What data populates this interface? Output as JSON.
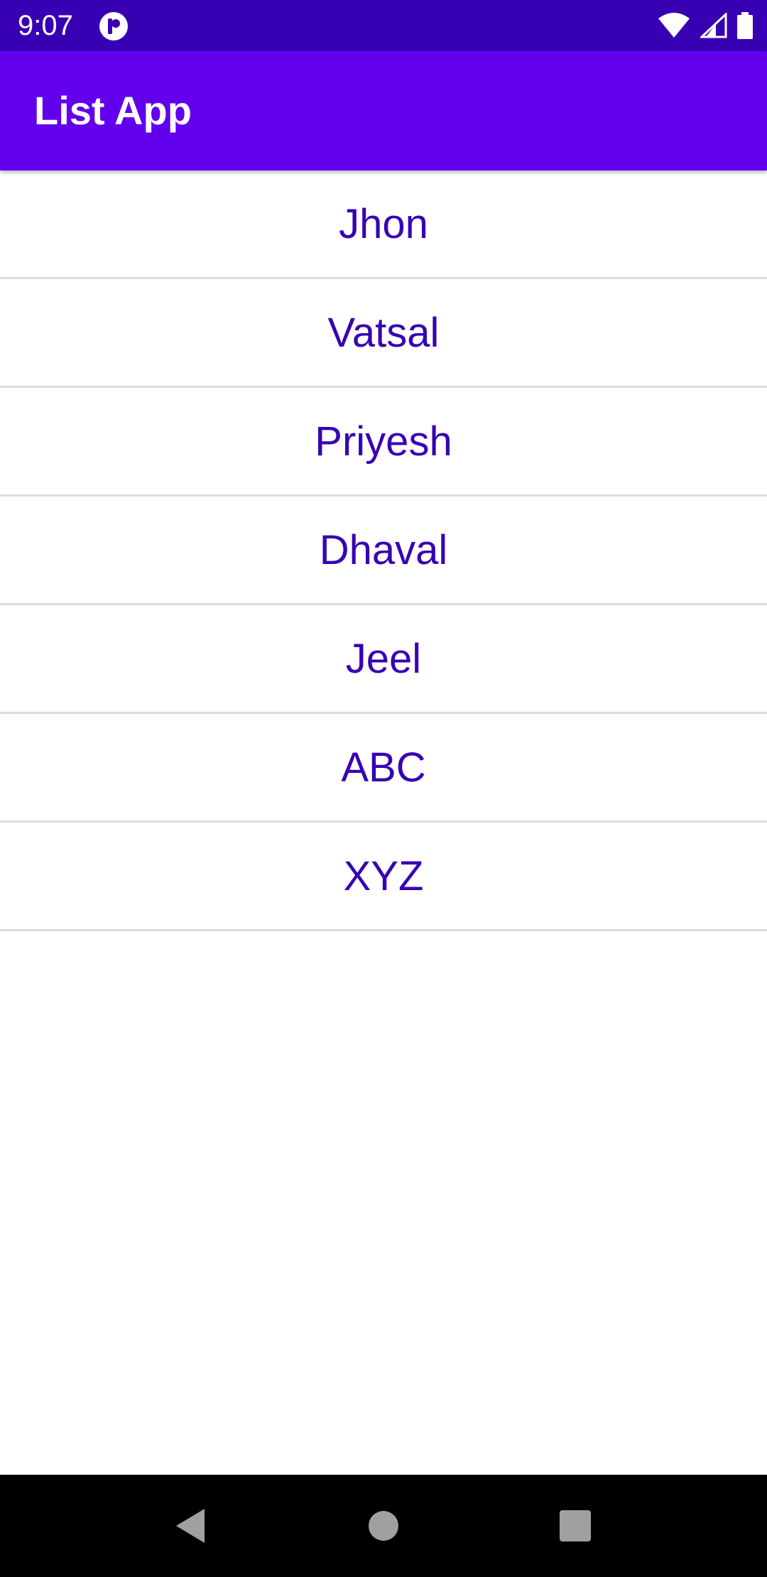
{
  "status_bar": {
    "time": "9:07",
    "app_icon": "circle-app-icon",
    "icons": [
      "wifi-icon",
      "signal-icon",
      "battery-icon"
    ]
  },
  "app_bar": {
    "title": "List App"
  },
  "list": {
    "items": [
      "Jhon",
      "Vatsal",
      "Priyesh",
      "Dhaval",
      "Jeel",
      "ABC",
      "XYZ"
    ]
  },
  "nav_bar": {
    "icons": [
      "back-icon",
      "home-icon",
      "recents-icon"
    ]
  },
  "colors": {
    "status_bar": "#3700b3",
    "app_bar": "#6200ee",
    "list_text": "#3700b3",
    "divider": "#dcdcdc",
    "nav_bar": "#000000"
  }
}
